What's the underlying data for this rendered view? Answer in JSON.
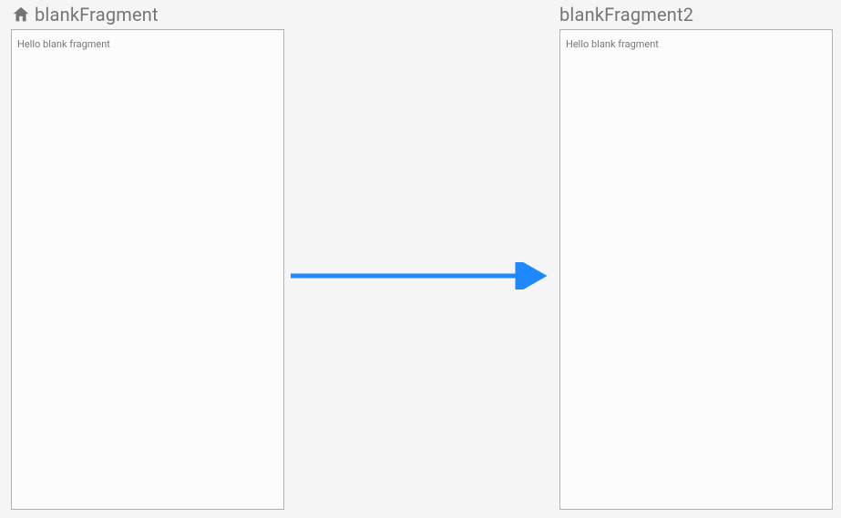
{
  "fragments": {
    "left": {
      "title": "blankFragment",
      "content": "Hello blank fragment",
      "is_start": true
    },
    "right": {
      "title": "blankFragment2",
      "content": "Hello blank fragment",
      "is_start": false
    }
  },
  "colors": {
    "arrow": "#1e88ff",
    "border": "#b0b0b0",
    "title": "#757575",
    "bg": "#f5f5f5",
    "card_bg": "#fcfcfc"
  }
}
